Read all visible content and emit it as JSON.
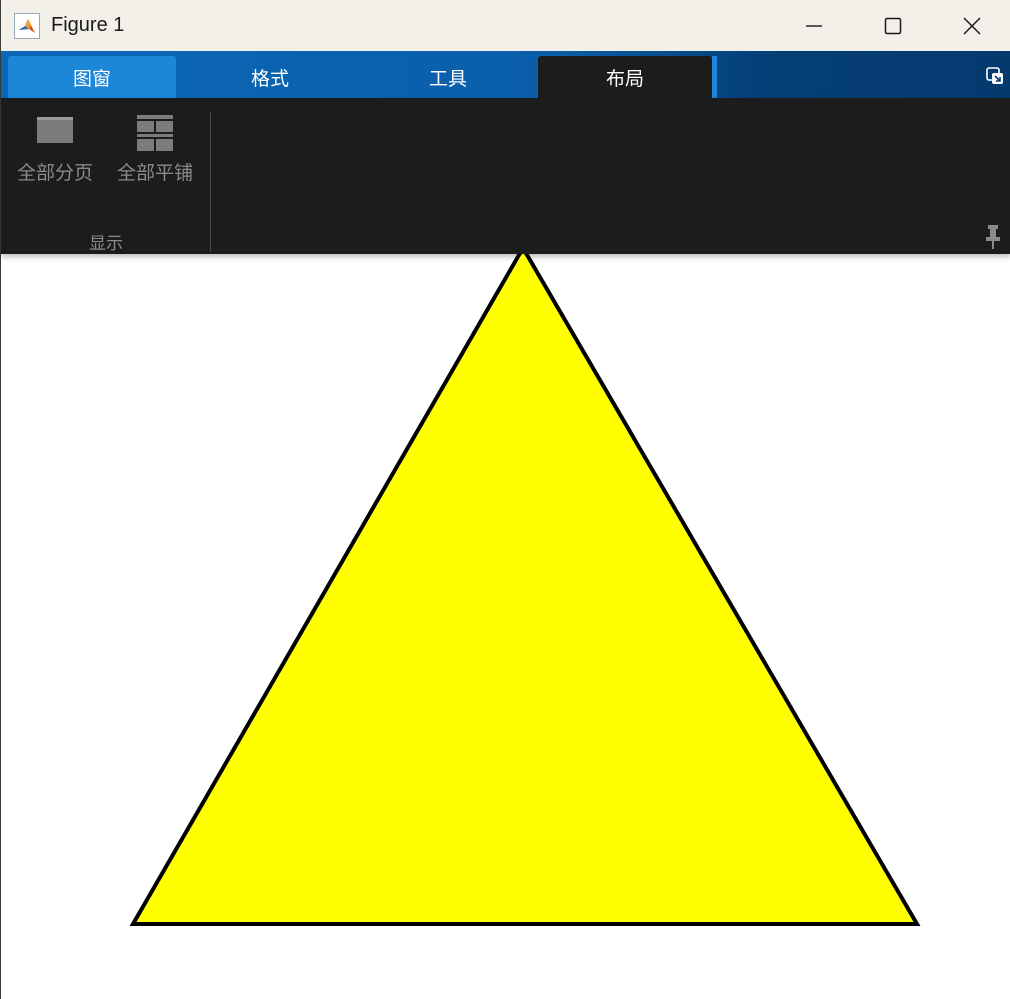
{
  "window": {
    "title": "Figure 1"
  },
  "tabs": [
    {
      "label": "图窗"
    },
    {
      "label": "格式"
    },
    {
      "label": "工具"
    },
    {
      "label": "布局"
    }
  ],
  "active_tab": "布局",
  "ribbon": {
    "buttons": [
      {
        "label": "全部分页",
        "icon": "tab-all-icon"
      },
      {
        "label": "全部平铺",
        "icon": "tile-all-icon"
      }
    ],
    "group_label": "显示"
  },
  "figure": {
    "shape": "triangle",
    "fill_color": "#ffff00",
    "edge_color": "#000000"
  },
  "colors": {
    "ribbon_bg": "#1c1c1c",
    "tab_blue": "#0a68b8",
    "tab_highlight": "#1c86d8",
    "titlebar_bg": "#f2f0e8"
  }
}
